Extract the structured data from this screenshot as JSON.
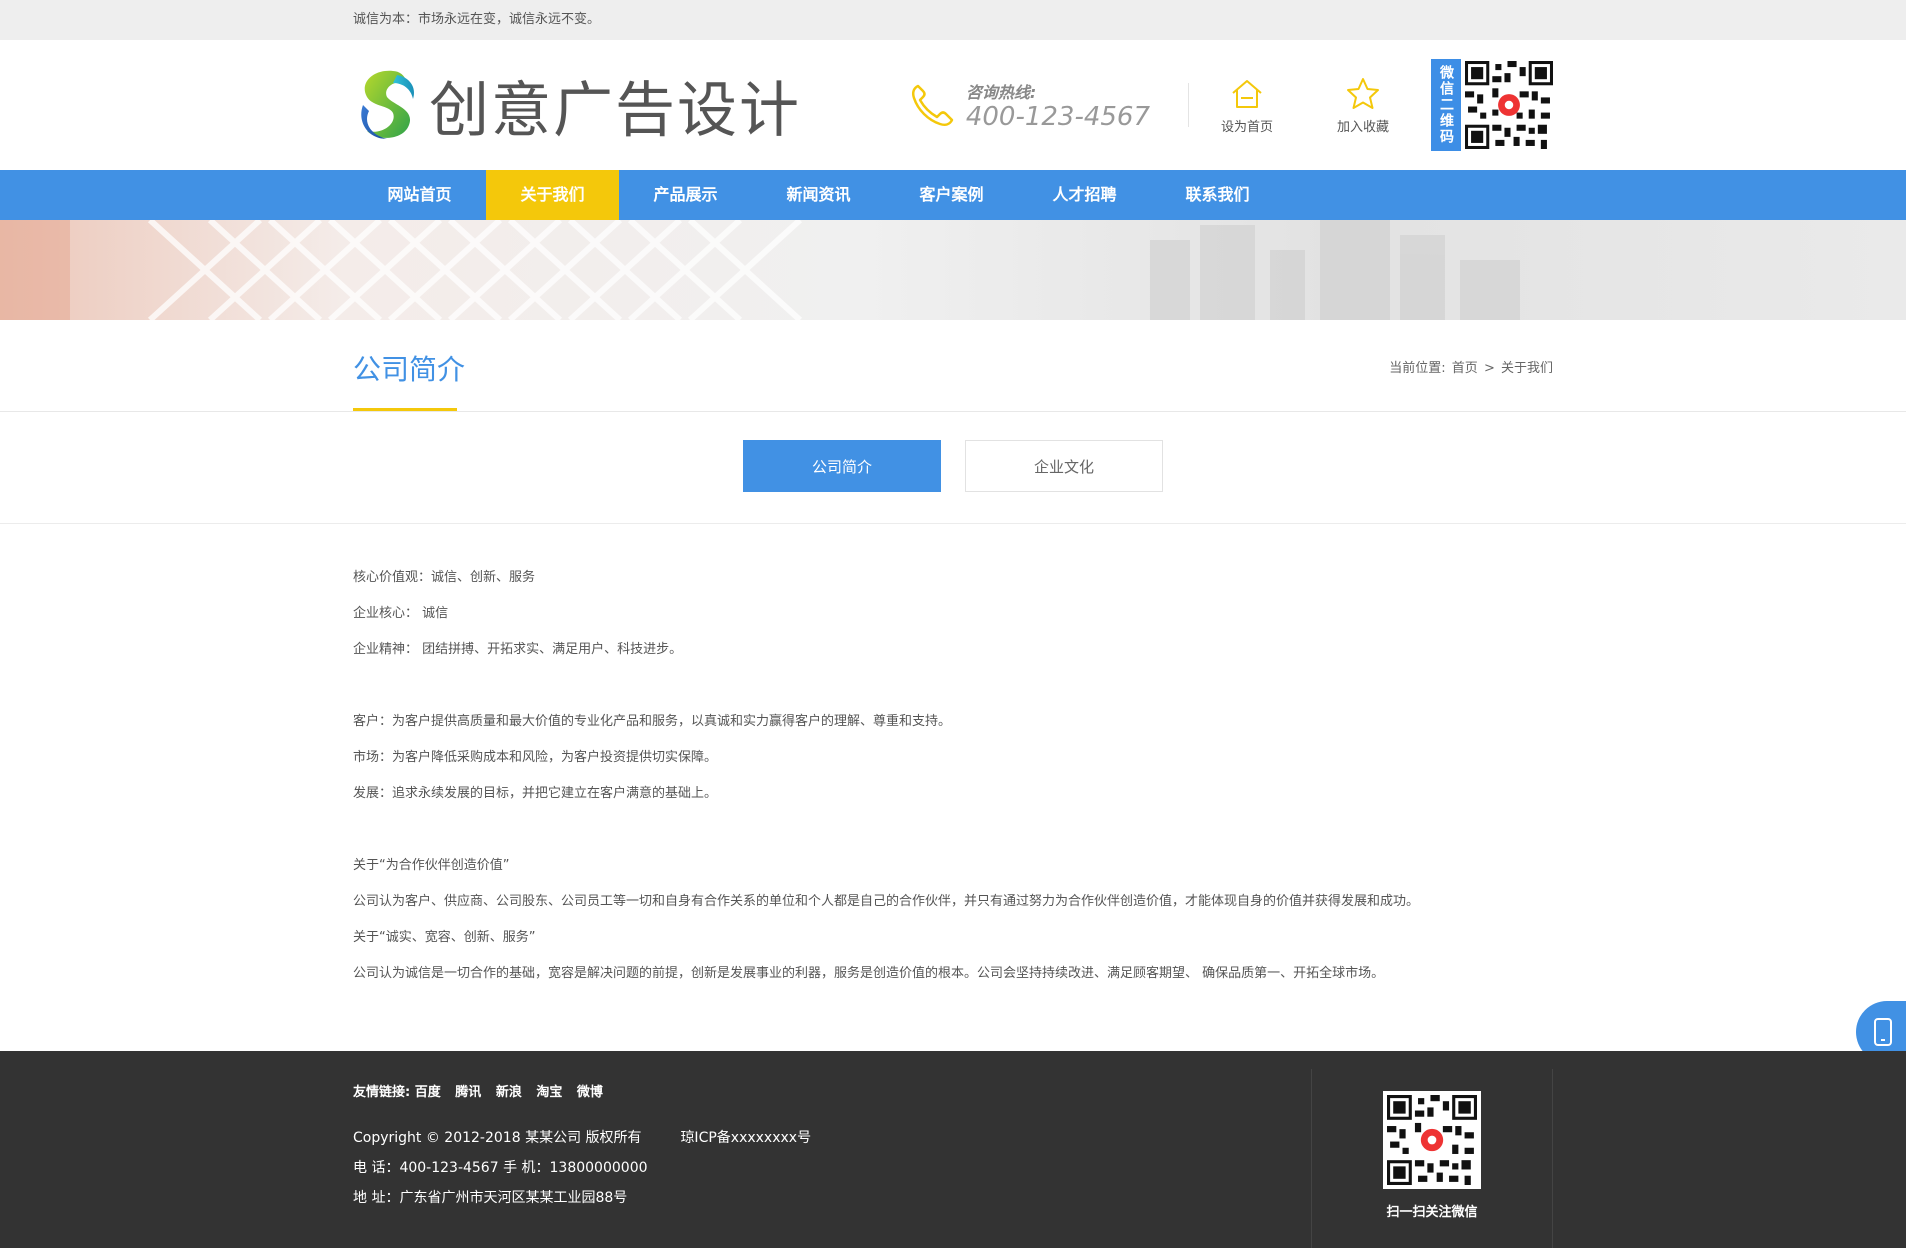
{
  "topbar": {
    "slogan": "诚信为本：市场永远在变，诚信永远不变。"
  },
  "header": {
    "logo_text": "创意广告设计",
    "hotline_label": "咨询热线:",
    "hotline_number": "400-123-4567",
    "set_home": "设为首页",
    "add_favorite": "加入收藏",
    "wechat_tag": "微信二维码"
  },
  "nav": {
    "items": [
      {
        "label": "网站首页"
      },
      {
        "label": "关于我们"
      },
      {
        "label": "产品展示"
      },
      {
        "label": "新闻资讯"
      },
      {
        "label": "客户案例"
      },
      {
        "label": "人才招聘"
      },
      {
        "label": "联系我们"
      }
    ],
    "active_index": 1
  },
  "section": {
    "title": "公司简介",
    "breadcrumb_prefix": "当前位置:",
    "breadcrumb_home": "首页",
    "breadcrumb_sep": ">",
    "breadcrumb_current": "关于我们"
  },
  "tabs": [
    {
      "label": "公司简介"
    },
    {
      "label": "企业文化"
    }
  ],
  "content": {
    "lines": [
      "核心价值观：诚信、创新、服务",
      "企业核心：  诚信",
      "企业精神：  团结拼搏、开拓求实、满足用户、科技进步。",
      "",
      "客户：为客户提供高质量和最大价值的专业化产品和服务，以真诚和实力赢得客户的理解、尊重和支持。",
      "市场：为客户降低采购成本和风险，为客户投资提供切实保障。",
      "发展：追求永续发展的目标，并把它建立在客户满意的基础上。",
      "",
      "关于“为合作伙伴创造价值”",
      "公司认为客户、供应商、公司股东、公司员工等一切和自身有合作关系的单位和个人都是自己的合作伙伴，并只有通过努力为合作伙伴创造价值，才能体现自身的价值并获得发展和成功。",
      "关于“诚实、宽容、创新、服务”",
      "公司认为诚信是一切合作的基础，宽容是解决问题的前提，创新是发展事业的利器，服务是创造价值的根本。公司会坚持持续改进、满足顾客期望、 确保品质第一、开拓全球市场。"
    ]
  },
  "footer": {
    "friend_label": "友情链接:",
    "friend_links": [
      "百度",
      "腾讯",
      "新浪",
      "淘宝",
      "微博"
    ],
    "copyright": "Copyright © 2012-2018 某某公司 版权所有",
    "icp": "琼ICP备xxxxxxxx号",
    "phone": "电 话：400-123-4567   手 机：13800000000",
    "address": "地 址：广东省广州市天河区某某工业园88号",
    "qr_label": "扫一扫关注微信"
  },
  "colors": {
    "primary_blue": "#4191e4",
    "accent_yellow": "#f4c80b",
    "footer_bg": "#333333",
    "topbar_bg": "#eeeeee"
  }
}
